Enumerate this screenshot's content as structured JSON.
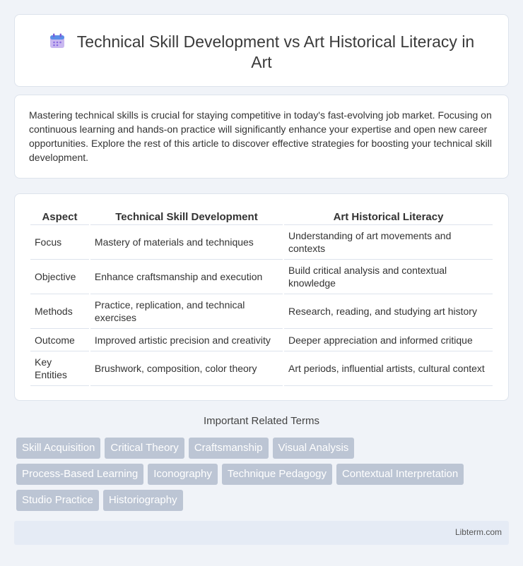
{
  "header": {
    "title_line1": "Technical Skill Development vs Art Historical Literacy in",
    "title_line2": "Art",
    "icon": "calendar-icon"
  },
  "intro": {
    "text": "Mastering technical skills is crucial for staying competitive in today's fast-evolving job market. Focusing on continuous learning and hands-on practice will significantly enhance your expertise and open new career opportunities. Explore the rest of this article to discover effective strategies for boosting your technical skill development."
  },
  "table": {
    "headers": [
      "Aspect",
      "Technical Skill Development",
      "Art Historical Literacy"
    ],
    "rows": [
      [
        "Focus",
        "Mastery of materials and techniques",
        "Understanding of art movements and contexts"
      ],
      [
        "Objective",
        "Enhance craftsmanship and execution",
        "Build critical analysis and contextual knowledge"
      ],
      [
        "Methods",
        "Practice, replication, and technical exercises",
        "Research, reading, and studying art history"
      ],
      [
        "Outcome",
        "Improved artistic precision and creativity",
        "Deeper appreciation and informed critique"
      ],
      [
        "Key Entities",
        "Brushwork, composition, color theory",
        "Art periods, influential artists, cultural context"
      ]
    ]
  },
  "related": {
    "title": "Important Related Terms",
    "rows": [
      [
        "Skill Acquisition",
        "Critical Theory",
        "Craftsmanship",
        "Visual Analysis"
      ],
      [
        "Process-Based Learning",
        "Iconography",
        "Technique Pedagogy",
        "Contextual Interpretation"
      ],
      [
        "Studio Practice",
        "Historiography"
      ]
    ]
  },
  "footer": {
    "site": "Libterm.com"
  }
}
